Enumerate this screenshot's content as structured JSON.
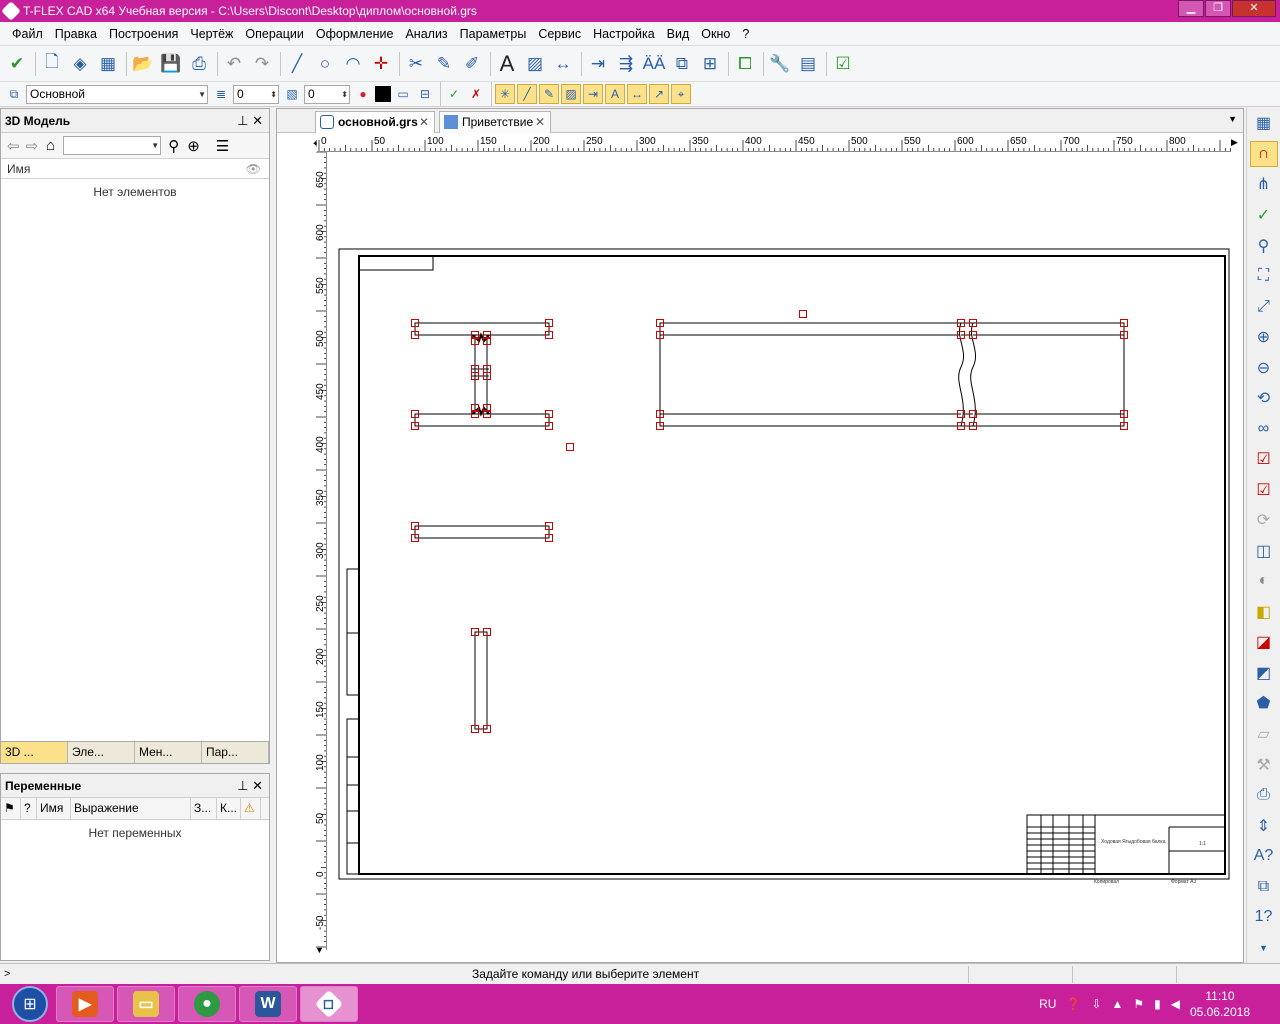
{
  "window": {
    "title": "T-FLEX CAD x64 Учебная версия - C:\\Users\\Discont\\Desktop\\диплом\\основной.grs"
  },
  "menu": [
    "Файл",
    "Правка",
    "Построения",
    "Чертёж",
    "Операции",
    "Оформление",
    "Анализ",
    "Параметры",
    "Сервис",
    "Настройка",
    "Вид",
    "Окно",
    "?"
  ],
  "toolbar2": {
    "layer": "Основной",
    "level_value": "0",
    "priority_value": "0"
  },
  "model_panel": {
    "title": "3D Модель",
    "col_name": "Имя",
    "empty": "Нет элементов",
    "tabs": [
      "3D ...",
      "Эле...",
      "Мен...",
      "Пар..."
    ]
  },
  "var_panel": {
    "title": "Переменные",
    "cols": [
      "?",
      "Имя",
      "Выражение",
      "З...",
      "К..."
    ],
    "empty": "Нет переменных"
  },
  "doc_tabs": [
    {
      "label": "основной.grs",
      "active": true
    },
    {
      "label": "Приветствие",
      "active": false
    }
  ],
  "hruler_ticks": [
    "0",
    "50",
    "100",
    "150",
    "200",
    "250",
    "300",
    "350",
    "400",
    "450",
    "500",
    "550",
    "600",
    "650",
    "700",
    "750",
    "800"
  ],
  "vruler_ticks": [
    "650",
    "600",
    "550",
    "500",
    "450",
    "400",
    "350",
    "300",
    "250",
    "200",
    "150",
    "100",
    "50",
    "0",
    "-50"
  ],
  "titleblock": {
    "name": "Ходовая Ягыдобовая балка",
    "scale": "1:1",
    "sheet": "Формат А3",
    "copied": "Копировал"
  },
  "status": {
    "message": "Задайте команду или выберите элемент"
  },
  "tray": {
    "lang": "RU",
    "time": "11:10",
    "date": "05.06.2018"
  },
  "colors": {
    "titlebar": "#c81f9a",
    "handle": "#d00000",
    "accent": "#fbe28a"
  }
}
